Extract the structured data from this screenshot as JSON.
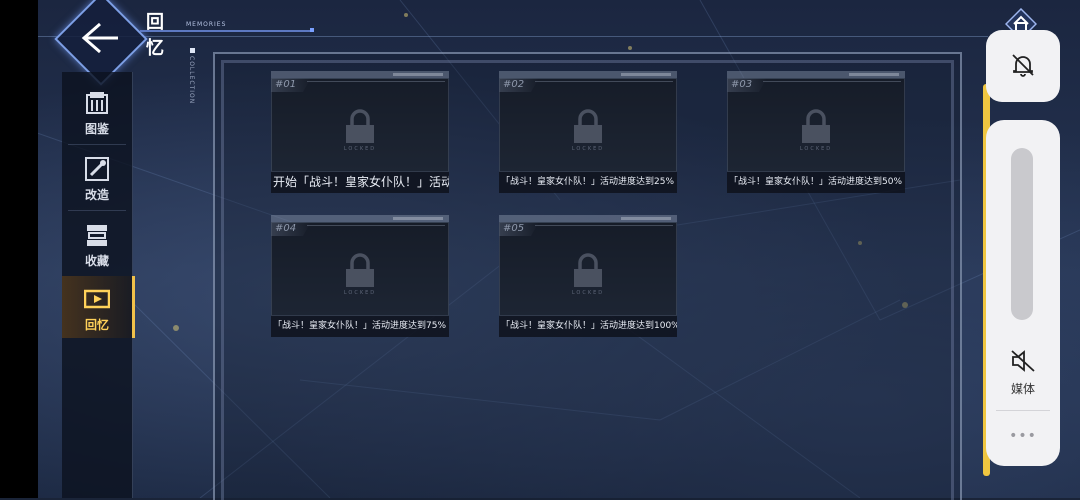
{
  "header": {
    "title_cn": "回忆",
    "title_en": "MEMORIES"
  },
  "sidebar": {
    "items": [
      {
        "label": "图鉴",
        "icon": "book-icon"
      },
      {
        "label": "改造",
        "icon": "wrench-icon"
      },
      {
        "label": "收藏",
        "icon": "collection-icon"
      },
      {
        "label": "回忆",
        "icon": "film-icon",
        "active": true
      }
    ]
  },
  "collection_label": "COLLECTION",
  "cards": [
    {
      "num": "#01",
      "locked_text": "LOCKED",
      "caption": "开始「战斗！皇家女仆队！」活动"
    },
    {
      "num": "#02",
      "locked_text": "LOCKED",
      "caption": "「战斗！皇家女仆队！」活动进度达到25%"
    },
    {
      "num": "#03",
      "locked_text": "LOCKED",
      "caption": "「战斗！皇家女仆队！」活动进度达到50%"
    },
    {
      "num": "#04",
      "locked_text": "LOCKED",
      "caption": "「战斗！皇家女仆队！」活动进度达到75%"
    },
    {
      "num": "#05",
      "locked_text": "LOCKED",
      "caption": "「战斗！皇家女仆队！」活动进度达到100%"
    }
  ],
  "system_overlay": {
    "volume_label": "媒体",
    "more": "•••"
  },
  "colors": {
    "accent": "#f0c640",
    "active_label": "#ffd25a",
    "back_border": "#7d9fe6"
  }
}
